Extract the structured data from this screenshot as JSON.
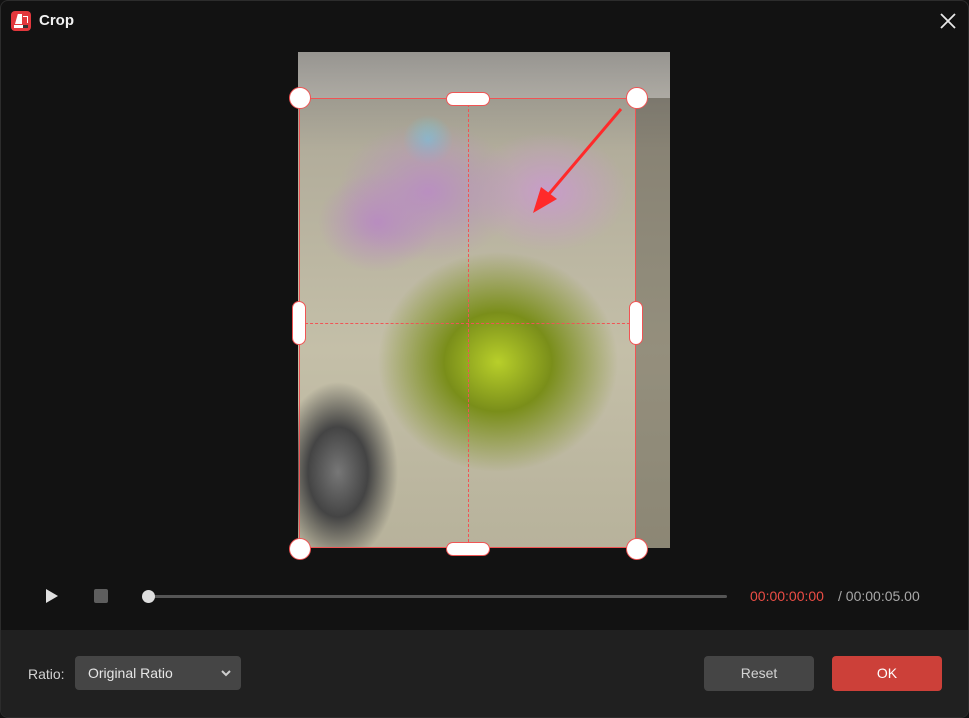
{
  "window": {
    "title": "Crop",
    "app_icon": "video-editor-app-icon",
    "close_icon": "close-icon"
  },
  "preview": {
    "content": "photo of bouquet of pink and lime-green chrysanthemums",
    "annotation": "red arrow pointing to top-right crop handle",
    "crop_guides": "rule-of-thirds-center dashed lines"
  },
  "playback": {
    "play_icon": "play-icon",
    "stop_icon": "stop-icon",
    "progress": 0,
    "current_time": "00:00:00:00",
    "total_time": "/ 00:00:05.00"
  },
  "footer": {
    "ratio_label": "Ratio:",
    "ratio_value": "Original Ratio",
    "reset_label": "Reset",
    "ok_label": "OK"
  },
  "colors": {
    "accent": "#cc4039",
    "crop_border": "#f05454",
    "time_current": "#ec4d45"
  }
}
